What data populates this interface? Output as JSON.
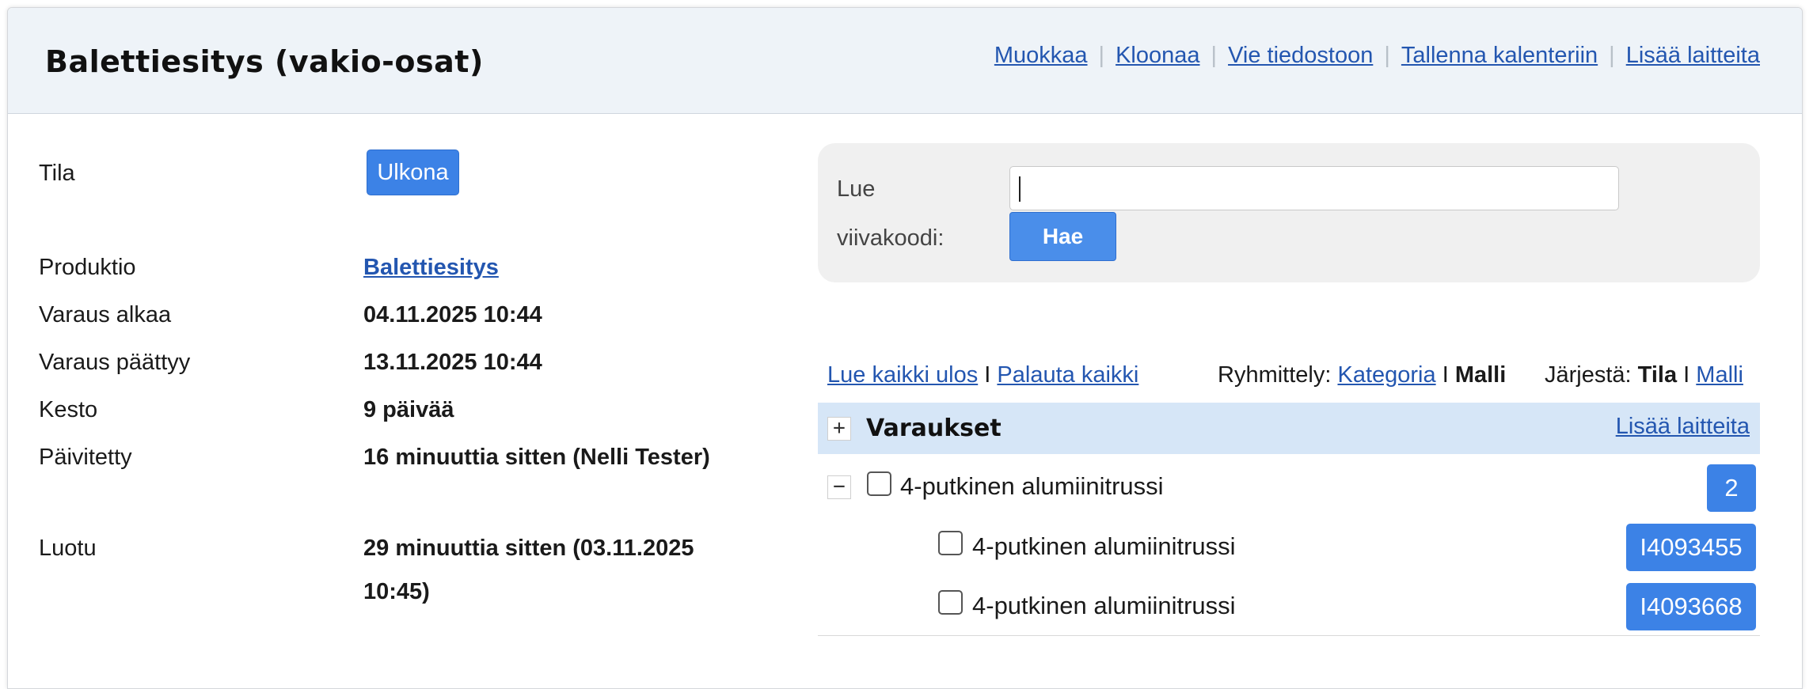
{
  "header": {
    "title": "Balettiesitys (vakio-osat)",
    "actions": {
      "edit": "Muokkaa",
      "clone": "Kloonaa",
      "export": "Vie tiedostoon",
      "save_calendar": "Tallenna kalenteriin",
      "add_equipment": "Lisää laitteita"
    },
    "separator": "|"
  },
  "info": {
    "status_label": "Tila",
    "status_value": "Ulkona",
    "production_label": "Produktio",
    "production_value": "Balettiesitys",
    "start_label": "Varaus alkaa",
    "start_value": "04.11.2025 10:44",
    "end_label": "Varaus päättyy",
    "end_value": "13.11.2025 10:44",
    "duration_label": "Kesto",
    "duration_value": "9 päivää",
    "updated_label": "Päivitetty",
    "updated_value": "16 minuuttia sitten (Nelli Tester)",
    "created_label": "Luotu",
    "created_value_line1": "29 minuuttia sitten (03.11.2025",
    "created_value_line2": "10:45)"
  },
  "scan": {
    "label_line1": "Lue",
    "label_line2": "viivakoodi:",
    "input_value": "",
    "button": "Hae"
  },
  "toolbar": {
    "checkout_all": "Lue kaikki ulos",
    "divider": "I",
    "return_all": "Palauta kaikki",
    "grouping_label": "Ryhmittely:",
    "grouping_category": "Kategoria",
    "grouping_model": "Malli",
    "sort_label": "Järjestä:",
    "sort_status": "Tila",
    "sort_model": "Malli"
  },
  "reservations": {
    "title": "Varaukset",
    "add_link": "Lisää laitteita",
    "expand_symbol": "+",
    "collapse_symbol": "−",
    "group": {
      "name": "4-putkinen alumiinitrussi",
      "count": "2"
    },
    "items": [
      {
        "name": "4-putkinen alumiinitrussi",
        "code": "I4093455"
      },
      {
        "name": "4-putkinen alumiinitrussi",
        "code": "I4093668"
      }
    ]
  },
  "colors": {
    "accent": "#3c82e6",
    "link": "#2356b0",
    "header_bg": "#eef3f8",
    "group_bg": "#d6e6f7"
  }
}
